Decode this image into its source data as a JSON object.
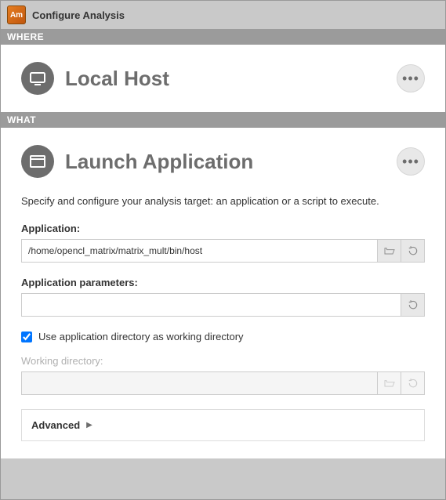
{
  "titlebar": {
    "icon_text": "Am",
    "title": "Configure Analysis"
  },
  "where": {
    "header": "WHERE",
    "title": "Local Host"
  },
  "what": {
    "header": "WHAT",
    "title": "Launch Application",
    "description": "Specify and configure your analysis target: an application or a script to execute.",
    "application_label": "Application:",
    "application_value": "/home/opencl_matrix/matrix_mult/bin/host",
    "params_label": "Application parameters:",
    "params_value": "",
    "use_app_dir_label": "Use application directory as working directory",
    "use_app_dir_checked": true,
    "working_dir_label": "Working directory:",
    "working_dir_value": "",
    "advanced_label": "Advanced"
  }
}
